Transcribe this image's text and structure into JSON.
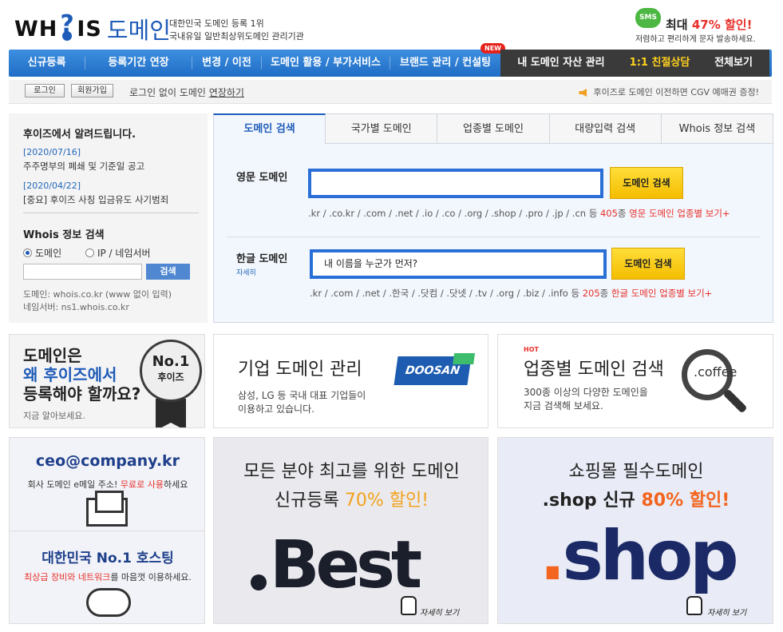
{
  "header": {
    "logo_text": "WH",
    "logo_q": "?",
    "logo_is": "IS",
    "logo_kr": "도메인",
    "tagline_1": "대한민국 도메인 등록 1위",
    "tagline_2": "국내유일 일반최상위도메인 관리기관",
    "sms_badge": "SMS",
    "sms_prefix": "최대",
    "sms_highlight": "47% 할인!",
    "sms_sub": "저렴하고 편리하게 문자 발송하세요."
  },
  "nav": {
    "items": [
      {
        "label": "신규등록"
      },
      {
        "label": "등록기간 연장"
      },
      {
        "label": "변경 / 이전"
      },
      {
        "label": "도메인 활용 / 부가서비스"
      },
      {
        "label": "브랜드 관리 / 컨설팅",
        "badge": "NEW"
      },
      {
        "label": "내 도메인 자산 관리"
      },
      {
        "label": "1:1 친절상담"
      },
      {
        "label": "전체보기"
      }
    ]
  },
  "loginbar": {
    "login": "로그인",
    "signup": "회원가입",
    "text_prefix": "로그인 없이 도메인",
    "text_link": "연장하기",
    "notice": "후이즈로 도메인 이전하면 CGV 예매권 증정!"
  },
  "left": {
    "title": "후이즈에서 알려드립니다.",
    "news": [
      {
        "date": "[2020/07/16]",
        "title": "주주명부의 폐쇄 및 기준일 공고"
      },
      {
        "date": "[2020/04/22]",
        "title": "[중요] 후이즈 사칭 입금유도 사기범죄"
      }
    ],
    "whois_title": "Whois 정보 검색",
    "radio_domain": "도메인",
    "radio_ip": "IP / 네임서버",
    "search_btn": "검색",
    "hint_1": "도메인: whois.co.kr (www 없이 입력)",
    "hint_2": "네임서버: ns1.whois.co.kr"
  },
  "search": {
    "tabs": [
      "도메인 검색",
      "국가별 도메인",
      "업종별 도메인",
      "대량입력 검색",
      "Whois 정보 검색"
    ],
    "en_label": "영문 도메인",
    "en_value": "",
    "en_btn": "도메인 검색",
    "en_tlds": ".kr / .co.kr / .com / .net / .io / .co / .org / .shop / .pro / .jp / .cn 등",
    "en_count": "405",
    "en_count_unit": "종",
    "en_link": "영문 도메인 업종별 보기+",
    "kr_label": "한글 도메인",
    "kr_sub": "자세히",
    "kr_value": "내 이름을 누군가 먼저?",
    "kr_btn": "도메인 검색",
    "kr_tlds": ".kr / .com / .net / .한국 / .닷컴 / .닷넷 / .tv / .org / .biz / .info 등",
    "kr_count": "205",
    "kr_count_unit": "종",
    "kr_link": "한글 도메인 업종별 보기+"
  },
  "banners": {
    "b1_l1": "도메인은",
    "b1_l2": "왜 후이즈에서",
    "b1_l3": "등록해야 할까요?",
    "b1_sm": "지금 알아보세요.",
    "b1_medal_n": "No.1",
    "b1_medal_h": "후이즈",
    "b2_title": "기업 도메인 관리",
    "b2_s1": "삼성, LG 등 국내 대표 기업들이",
    "b2_s2": "이용하고 있습니다.",
    "b2_logo": "DOOSAN",
    "b3_hot": "HOT",
    "b3_title": "업종별 도메인 검색",
    "b3_s1": "300종 이상의 다양한 도메인을",
    "b3_s2": "지금 검색해 보세요.",
    "b3_mag": ".coffee",
    "b4_t1": "ceo@company.kr",
    "b4_s1_a": "회사 도메인 e메일 주소!",
    "b4_s1_b": "무료로 사용",
    "b4_s1_c": "하세요",
    "b4_t2": "대한민국 No.1 호스팅",
    "b4_s2_a": "최상급 장비와 네트워크",
    "b4_s2_b": "를 마음껏 이용하세요.",
    "b5_l1": "모든 분야 최고를 위한 도메인",
    "b5_l2a": "신규등록",
    "b5_l2b": "70% 할인!",
    "b5_big": "Best",
    "b5_detail": "자세히 보기",
    "b6_l1": "쇼핑몰 필수도메인",
    "b6_l2a": ".shop 신규",
    "b6_l2b": "80% 할인!",
    "b6_big_dot": ".",
    "b6_big": "shop",
    "b6_detail": "자세히 보기"
  }
}
